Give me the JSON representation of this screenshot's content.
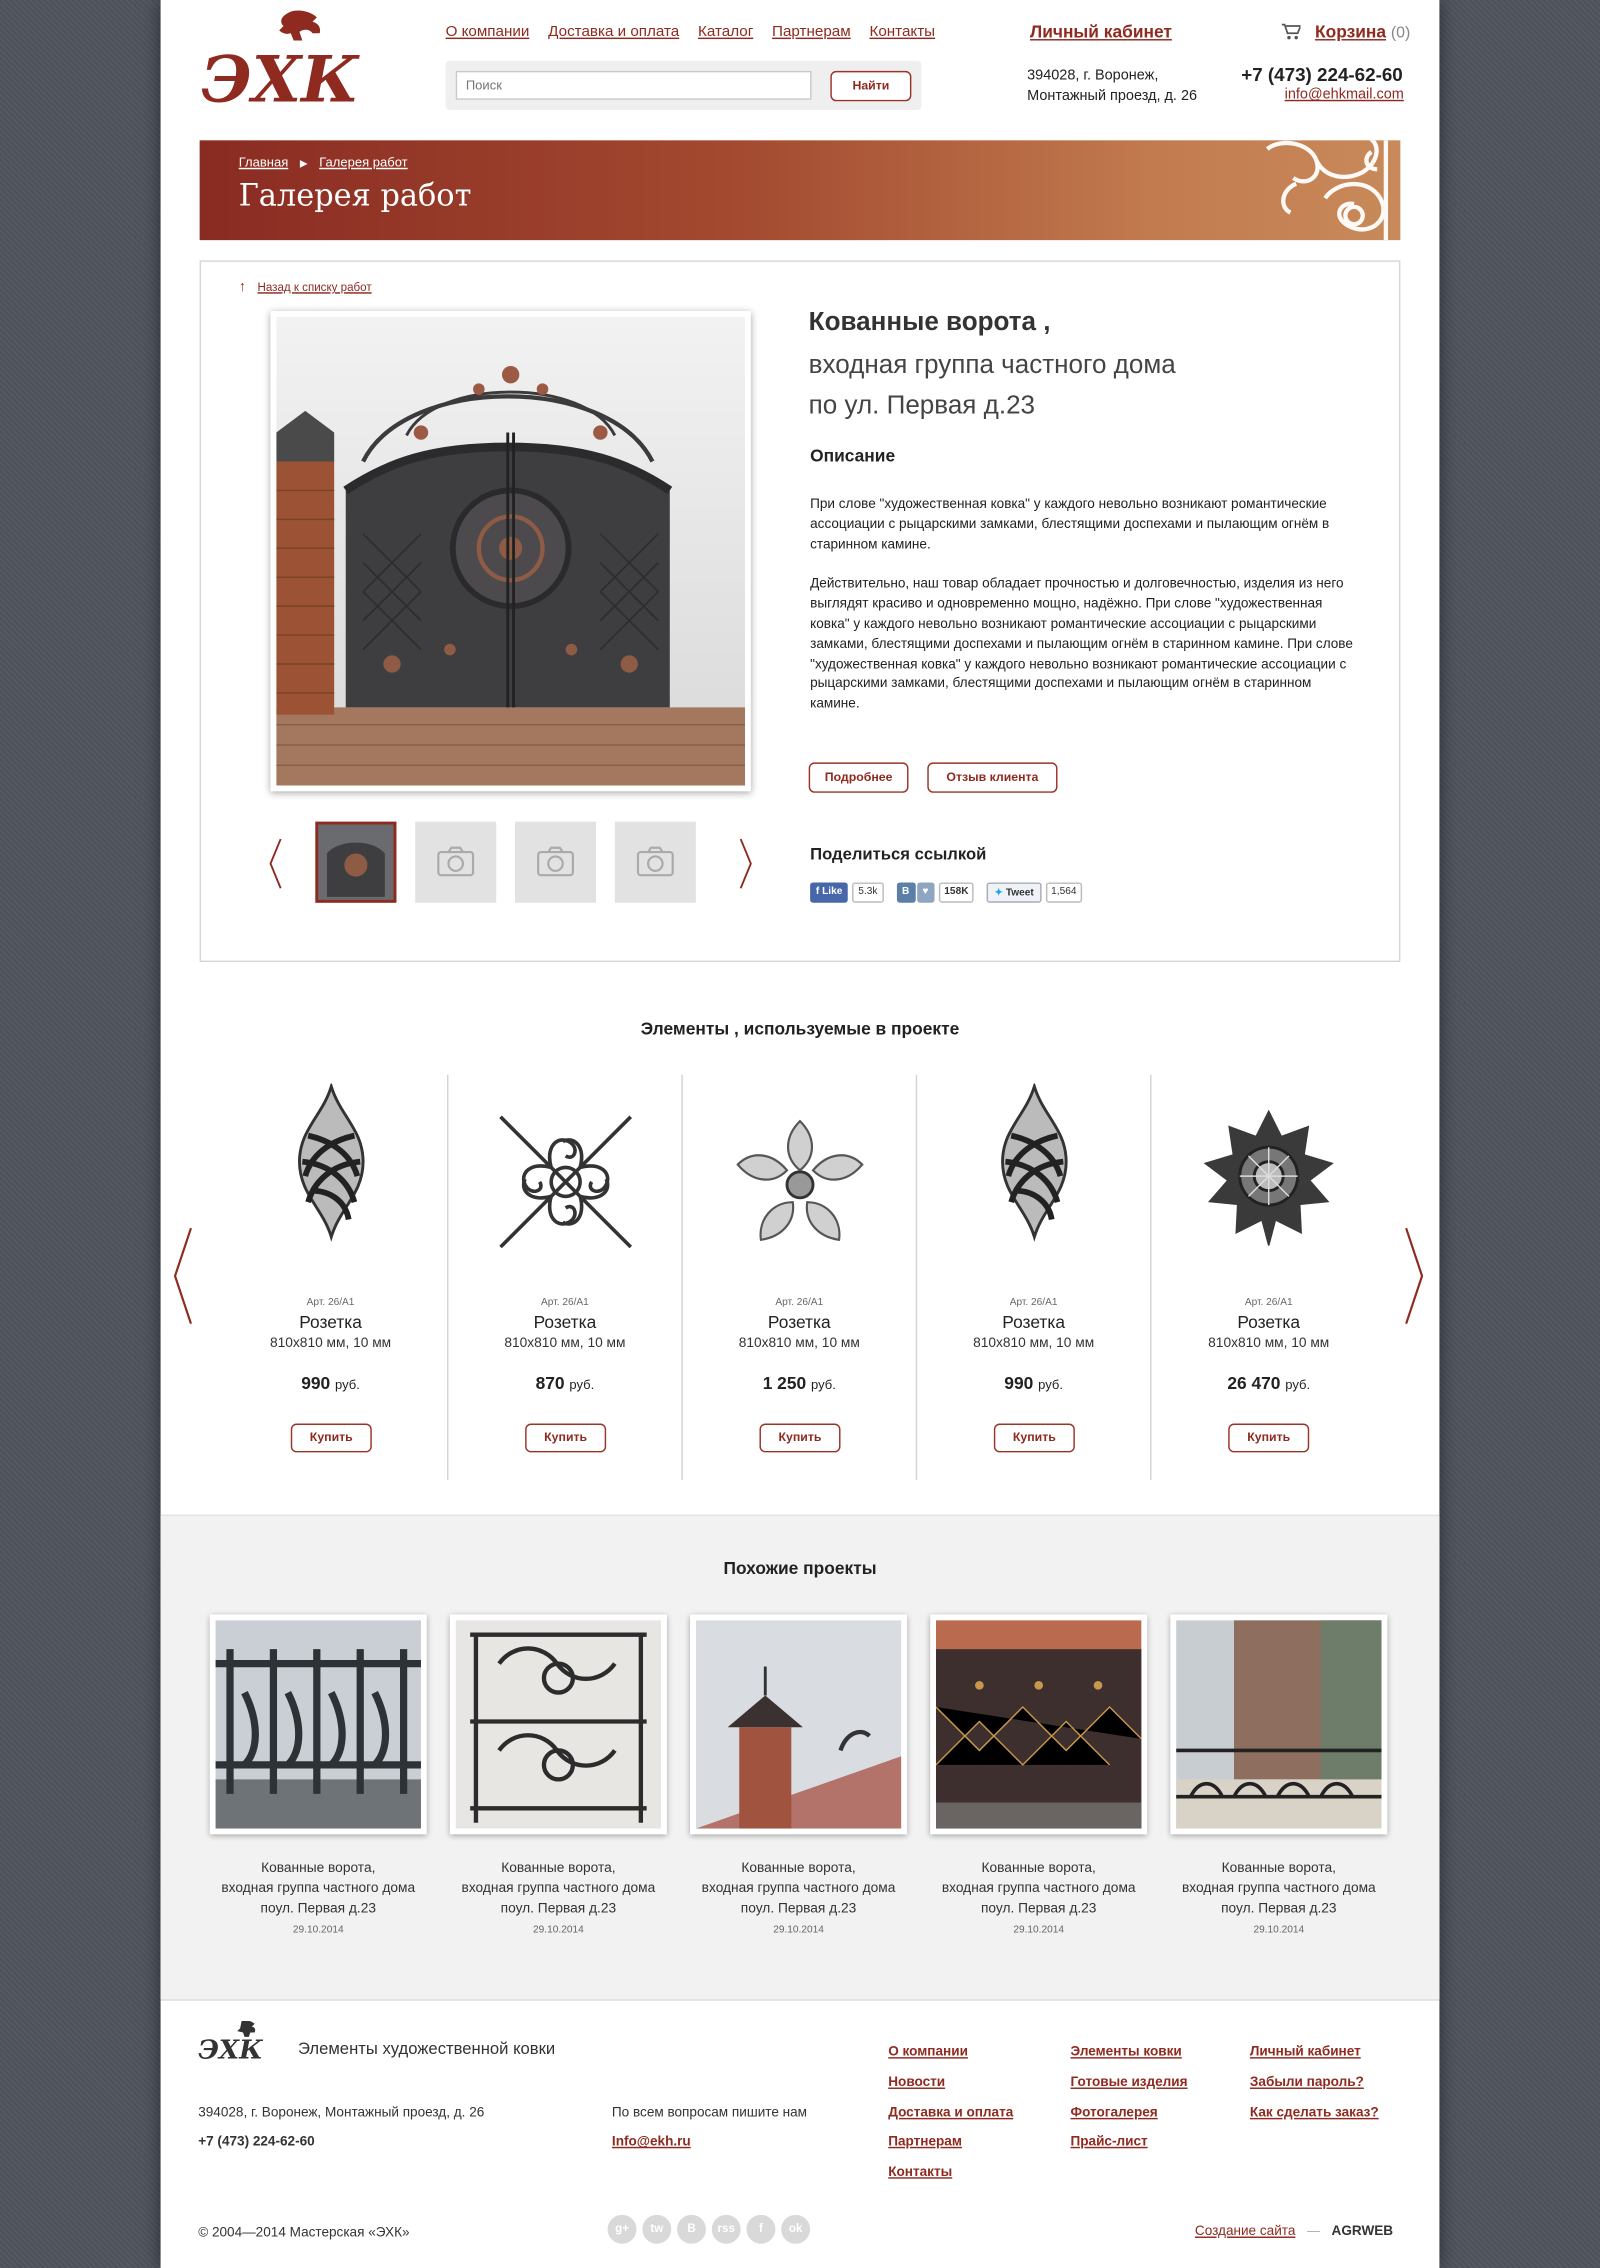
{
  "header": {
    "logo_text": "ЭХК",
    "nav": [
      "О компании",
      "Доставка и оплата",
      "Каталог",
      "Партнерам",
      "Контакты"
    ],
    "search_placeholder": "Поиск",
    "search_button": "Найти",
    "cabinet": "Личный кабинет",
    "address_line1": "394028, г. Воронеж,",
    "address_line2": "Монтажный проезд, д. 26",
    "cart_label": "Корзина",
    "cart_count": "(0)",
    "phone": "+7 (473) 224-62-60",
    "email": "info@ehkmail.com"
  },
  "banner": {
    "crumb_home": "Главная",
    "crumb_sep": "▶",
    "crumb_current": "Галерея работ",
    "title": "Галерея работ"
  },
  "project": {
    "back_arrow": "↑",
    "back_link": "Назад к списку работ",
    "title_bold": "Кованные ворота ,",
    "title_line2": "входная группа частного дома",
    "title_line3": "по ул. Первая д.23",
    "desc_heading": "Описание",
    "desc_p1": "При слове \"художественная ковка\" у каждого невольно возникают романтические ассоциации с рыцарскими замками, блестящими доспехами и пылающим огнём в старинном камине.",
    "desc_p2": "Действительно, наш товар обладает прочностью и долговечностью, изделия из него выглядят красиво и одновременно мощно, надёжно. При слове \"художественная ковка\" у каждого невольно возникают романтические ассоциации с рыцарскими замками, блестящими доспехами и пылающим огнём в старинном камине. При слове \"художественная ковка\" у каждого невольно возникают романтические ассоциации с рыцарскими замками, блестящими доспехами и пылающим огнём в старинном камине.",
    "more_button": "Подробнее",
    "review_button": "Отзыв клиента",
    "share_heading": "Поделиться ссылкой",
    "share": {
      "fb_label": "Like",
      "fb_count": "5.3k",
      "vk_label": "В",
      "vk_heart": "♥",
      "vk_count": "158K",
      "tw_label": "Tweet",
      "tw_count": "1,564"
    },
    "thumb_icon": "camera-icon"
  },
  "elements": {
    "heading": "Элементы , используемые в проекте",
    "items": [
      {
        "art": "Арт. 26/А1",
        "name": "Розетка",
        "size": "810x810 мм, 10 мм",
        "price": "990",
        "currency": "руб.",
        "buy": "Купить",
        "icon": "twisted-basket-icon"
      },
      {
        "art": "Арт. 26/А1",
        "name": "Розетка",
        "size": "810x810 мм, 10 мм",
        "price": "870",
        "currency": "руб.",
        "buy": "Купить",
        "icon": "scroll-ornament-icon"
      },
      {
        "art": "Арт. 26/А1",
        "name": "Розетка",
        "size": "810x810 мм, 10 мм",
        "price": "1 250",
        "currency": "руб.",
        "buy": "Купить",
        "icon": "flower-rosette-icon"
      },
      {
        "art": "Арт. 26/А1",
        "name": "Розетка",
        "size": "810x810 мм, 10 мм",
        "price": "990",
        "currency": "руб.",
        "buy": "Купить",
        "icon": "twisted-basket-icon"
      },
      {
        "art": "Арт. 26/А1",
        "name": "Розетка",
        "size": "810x810 мм, 10 мм",
        "price": "26 470",
        "currency": "руб.",
        "buy": "Купить",
        "icon": "star-rosette-icon"
      }
    ]
  },
  "similar": {
    "heading": "Похожие проекты",
    "items": [
      {
        "l1": "Кованные ворота,",
        "l2": "входная группа частного дома",
        "l3": "поул. Первая д.23",
        "date": "29.10.2014"
      },
      {
        "l1": "Кованные ворота,",
        "l2": "входная группа частного дома",
        "l3": "поул. Первая д.23",
        "date": "29.10.2014"
      },
      {
        "l1": "Кованные ворота,",
        "l2": "входная группа частного дома",
        "l3": "поул. Первая д.23",
        "date": "29.10.2014"
      },
      {
        "l1": "Кованные ворота,",
        "l2": "входная группа частного дома",
        "l3": "поул. Первая д.23",
        "date": "29.10.2014"
      },
      {
        "l1": "Кованные ворота,",
        "l2": "входная группа частного дома",
        "l3": "поул. Первая д.23",
        "date": "29.10.2014"
      }
    ]
  },
  "footer": {
    "tagline": "Элементы художественной ковки",
    "address": "394028, г. Воронеж, Монтажный проезд, д. 26",
    "phone": "+7 (473) 224-62-60",
    "question": "По всем вопросам пишите нам",
    "email": "Info@ekh.ru",
    "col1": [
      "О компании",
      "Новости",
      "Доставка и оплата",
      "Партнерам",
      "Контакты"
    ],
    "col2": [
      "Элементы ковки",
      "Готовые изделия",
      "Фотогалерея",
      "Прайс-лист"
    ],
    "col3": [
      "Личный кабинет",
      "Забыли пароль?",
      "Как сделать заказ?"
    ],
    "copyright": "© 2004—2014 Мастерская «ЭХК»",
    "social": [
      "g+",
      "tw",
      "В",
      "rss",
      "f",
      "ok"
    ],
    "made_by": "Создание сайта",
    "dash": "—",
    "agency": "AGRWEB"
  },
  "colors": {
    "accent": "#8e2a1f",
    "banner_start": "#8a2b22",
    "banner_end": "#c88a5a",
    "background": "#50545d"
  }
}
